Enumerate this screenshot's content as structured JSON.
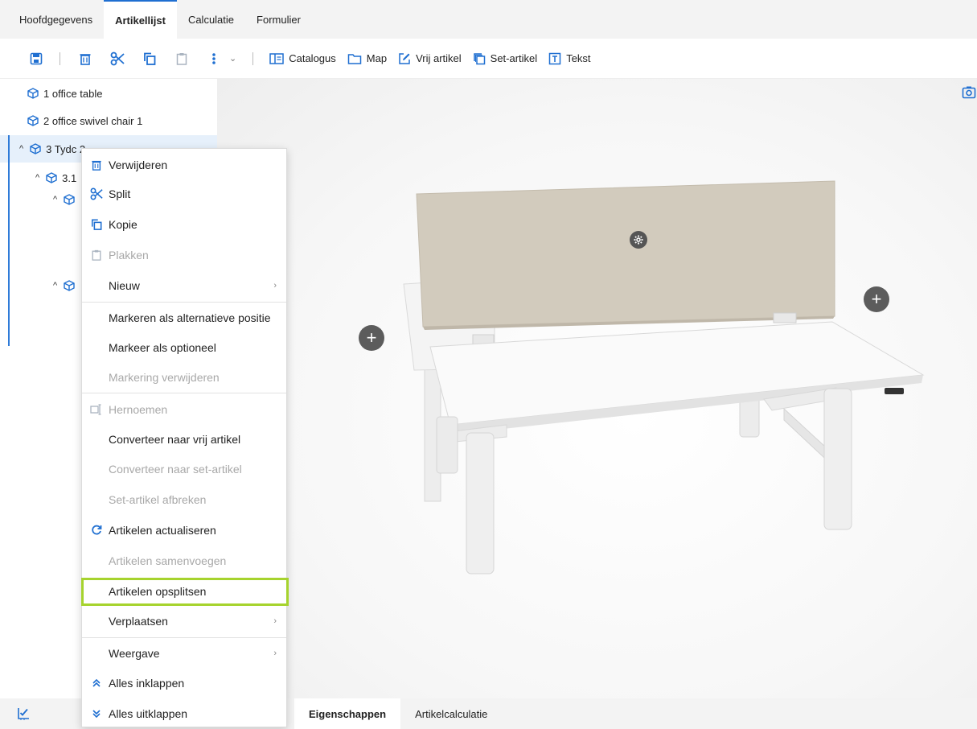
{
  "tabs": {
    "items": [
      {
        "label": "Hoofdgegevens"
      },
      {
        "label": "Artikellijst"
      },
      {
        "label": "Calculatie"
      },
      {
        "label": "Formulier"
      }
    ],
    "active": "Artikellijst"
  },
  "toolbar": {
    "catalogus": "Catalogus",
    "map": "Map",
    "vrij_artikel": "Vrij artikel",
    "set_artikel": "Set-artikel",
    "tekst": "Tekst"
  },
  "tree": {
    "items": [
      {
        "label": "1 office table"
      },
      {
        "label": "2 office swivel chair 1"
      },
      {
        "label": "3 Tydc 2"
      },
      {
        "label": "3.1"
      }
    ]
  },
  "context_menu": {
    "verwijderen": "Verwijderen",
    "split": "Split",
    "kopie": "Kopie",
    "plakken": "Plakken",
    "nieuw": "Nieuw",
    "markeren_alternatief": "Markeren als alternatieve positie",
    "markeer_optioneel": "Markeer als optioneel",
    "markering_verwijderen": "Markering verwijderen",
    "hernoemen": "Hernoemen",
    "converteer_vrij": "Converteer naar vrij artikel",
    "converteer_set": "Converteer naar set-artikel",
    "set_afbreken": "Set-artikel afbreken",
    "actualiseren": "Artikelen actualiseren",
    "samenvoegen": "Artikelen samenvoegen",
    "opsplitsen": "Artikelen opsplitsen",
    "verplaatsen": "Verplaatsen",
    "weergave": "Weergave",
    "inklappen": "Alles inklappen",
    "uitklappen": "Alles uitklappen"
  },
  "bottom_tabs": {
    "eigenschappen": "Eigenschappen",
    "artikelcalculatie": "Artikelcalculatie"
  },
  "colors": {
    "accent": "#1f6fd1",
    "highlight": "#a6d32e",
    "panel": "#d2cbbd"
  }
}
